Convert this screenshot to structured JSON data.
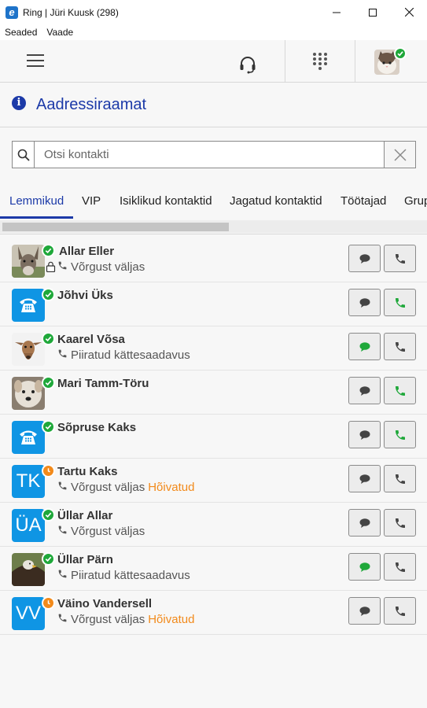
{
  "window": {
    "title": "Ring | Jüri Kuusk (298)"
  },
  "menu": {
    "items": [
      "Seaded",
      "Vaade"
    ]
  },
  "header": {
    "title": "Aadressiraamat"
  },
  "search": {
    "placeholder": "Otsi kontakti",
    "value": ""
  },
  "tabs": [
    "Lemmikud",
    "VIP",
    "Isiklikud kontaktid",
    "Jagatud kontaktid",
    "Töötajad",
    "Grup"
  ],
  "active_tab": "Lemmikud",
  "colors": {
    "accent": "#1c3aa8",
    "available": "#1fa83a",
    "away": "#f28a1b",
    "avatar_blue": "#0f95e4"
  },
  "contacts": [
    {
      "name": "Allar Eller",
      "status": "Võrgust väljas",
      "busy": "",
      "presence": "available",
      "avatar": "donkey-photo",
      "locked": true,
      "chat_active": false,
      "call_active": false
    },
    {
      "name": "Jõhvi Üks",
      "status": "",
      "busy": "",
      "presence": "available",
      "avatar": "phone-icon",
      "locked": false,
      "chat_active": false,
      "call_active": true
    },
    {
      "name": "Kaarel Võsa",
      "status": "Piiratud kättesaadavus",
      "busy": "",
      "presence": "available",
      "avatar": "goat-photo",
      "locked": false,
      "chat_active": true,
      "call_active": false
    },
    {
      "name": "Mari Tamm-Töru",
      "status": "",
      "busy": "",
      "presence": "available",
      "avatar": "dog-photo",
      "locked": false,
      "chat_active": false,
      "call_active": true
    },
    {
      "name": "Sõpruse Kaks",
      "status": "",
      "busy": "",
      "presence": "available",
      "avatar": "phone-icon",
      "locked": false,
      "chat_active": false,
      "call_active": true
    },
    {
      "name": "Tartu Kaks",
      "status": "Võrgust väljas",
      "busy": "Hõivatud",
      "presence": "away",
      "avatar": "TK",
      "locked": false,
      "chat_active": false,
      "call_active": false
    },
    {
      "name": "Üllar Allar",
      "status": "Võrgust väljas",
      "busy": "",
      "presence": "available",
      "avatar": "ÜA",
      "locked": false,
      "chat_active": false,
      "call_active": false
    },
    {
      "name": "Üllar Pärn",
      "status": "Piiratud kättesaadavus",
      "busy": "",
      "presence": "available",
      "avatar": "eagle-photo",
      "locked": false,
      "chat_active": true,
      "call_active": false
    },
    {
      "name": "Väino Vandersell",
      "status": "Võrgust väljas",
      "busy": "Hõivatud",
      "presence": "away",
      "avatar": "VV",
      "locked": false,
      "chat_active": false,
      "call_active": false
    }
  ]
}
